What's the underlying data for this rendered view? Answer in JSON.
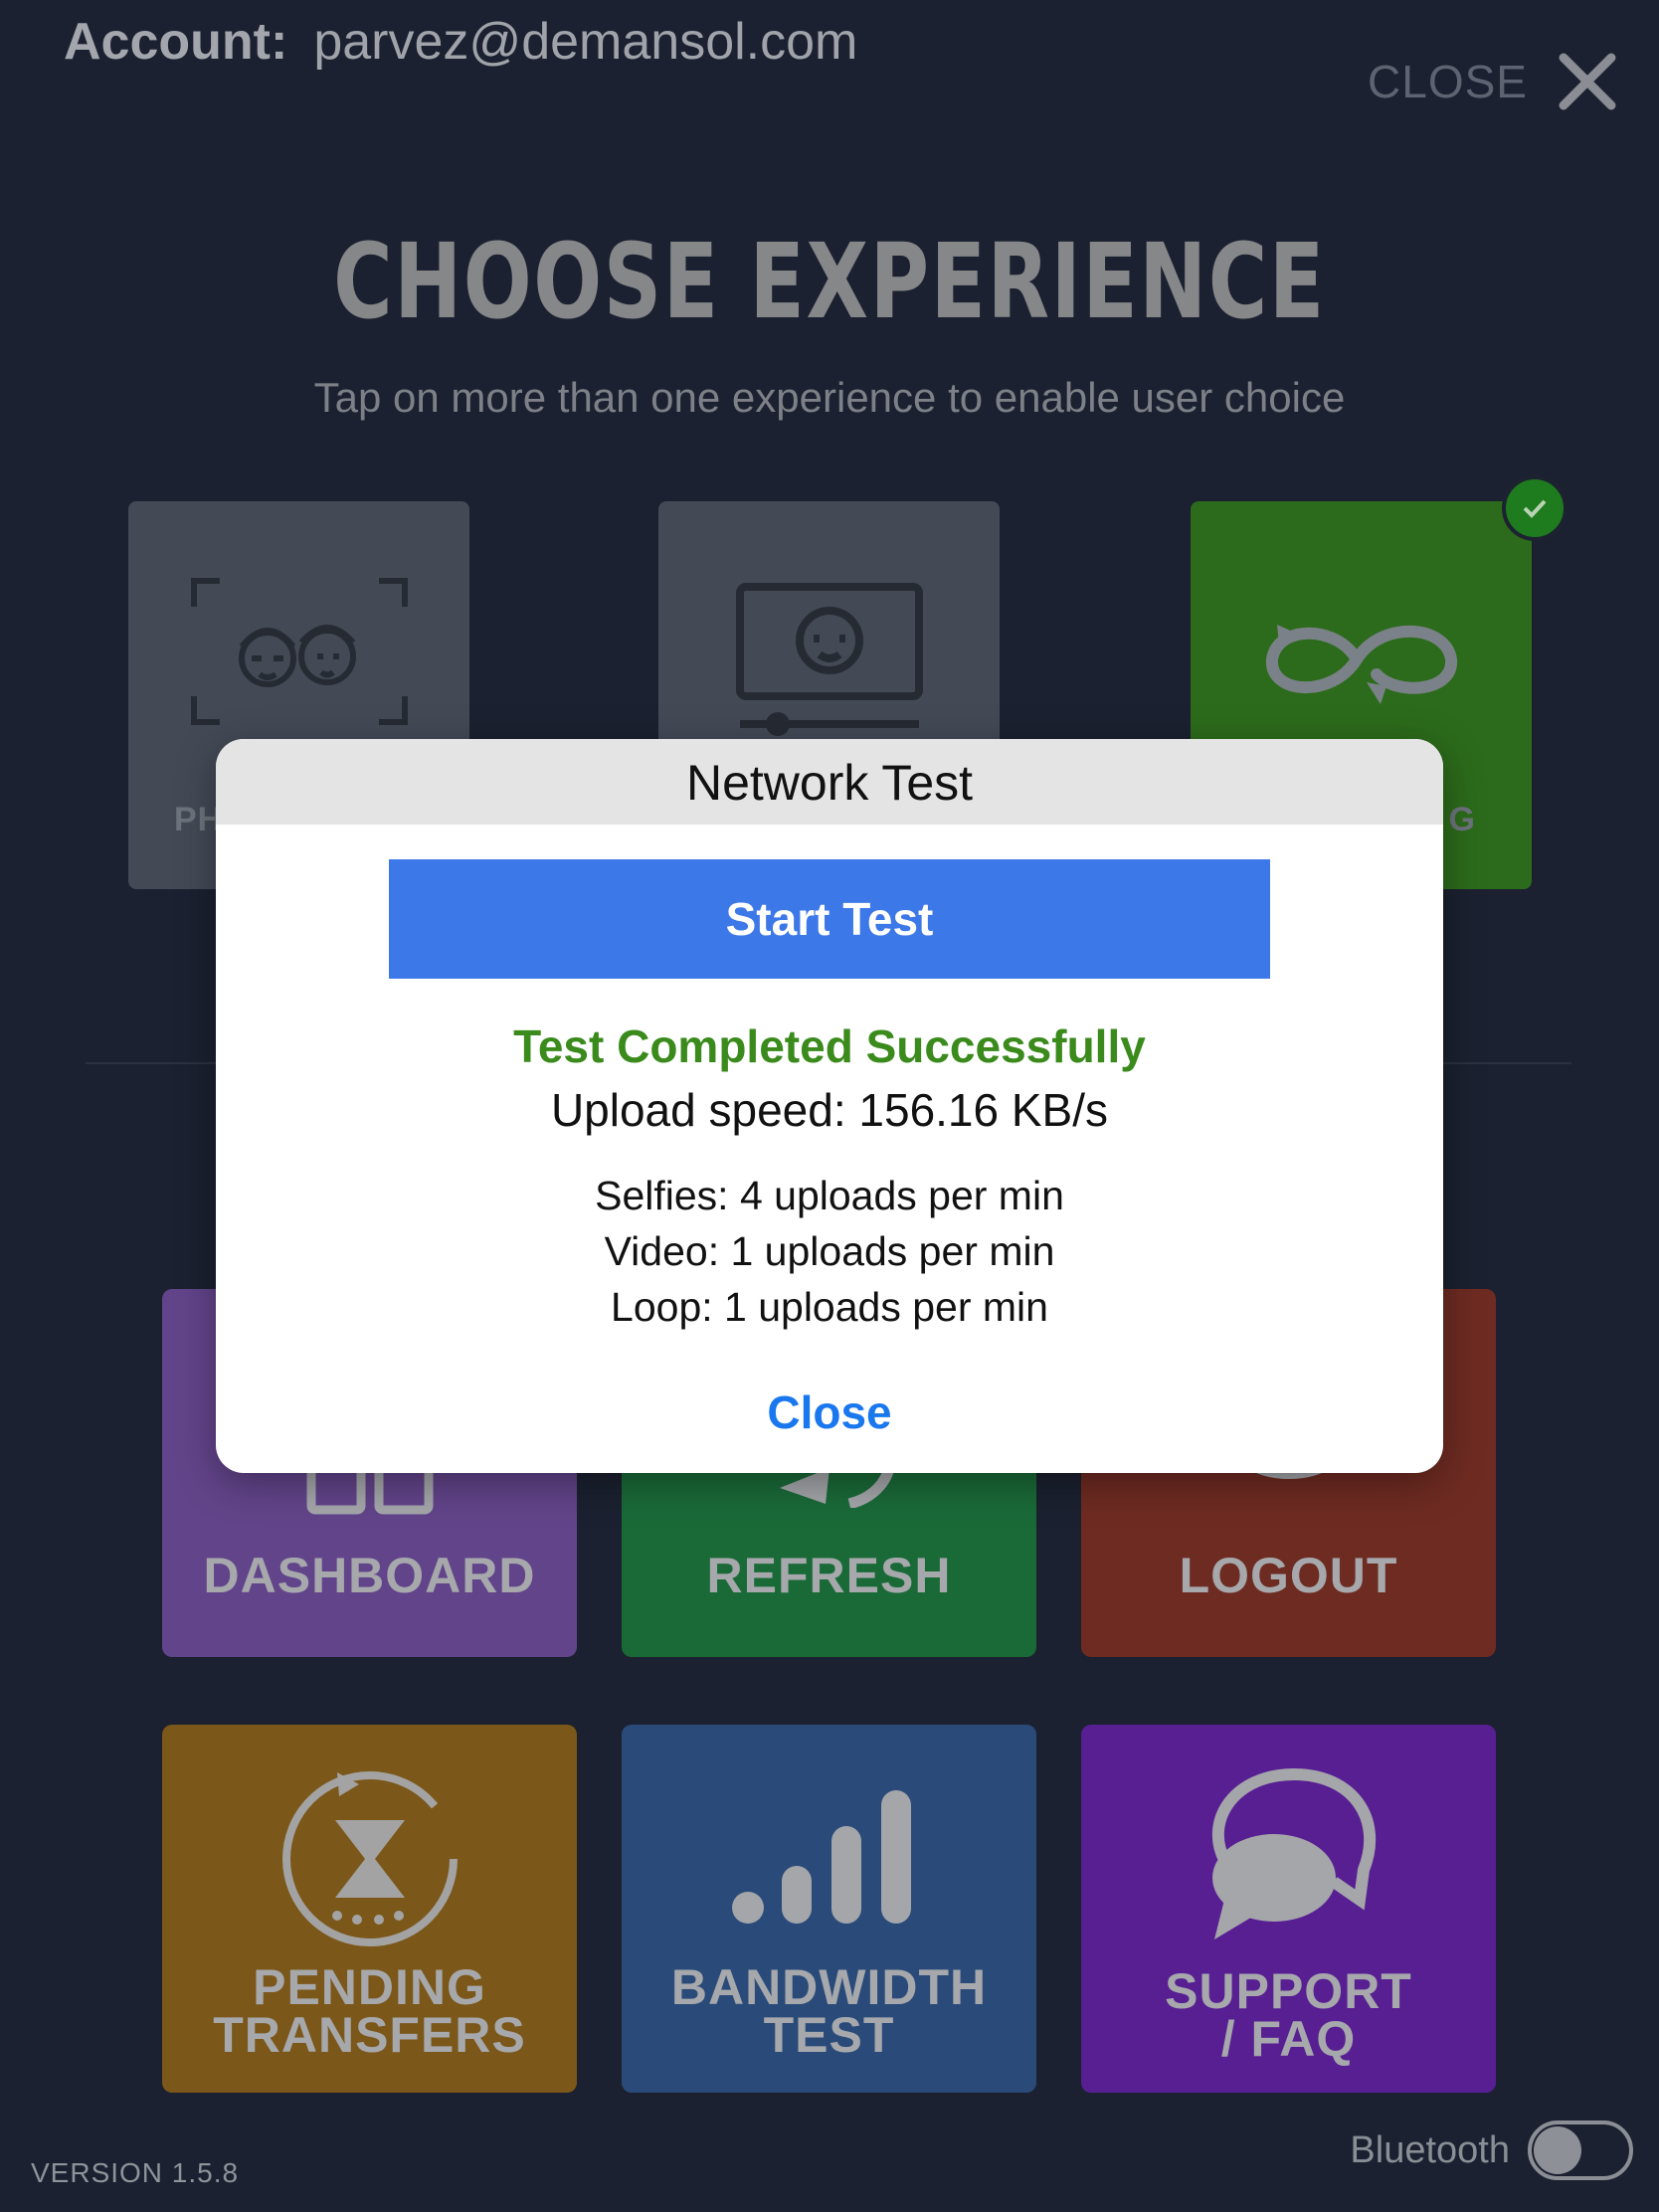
{
  "header": {
    "account_label": "Account:",
    "account_email": "parvez@demansol.com",
    "close_label": "CLOSE"
  },
  "choose": {
    "title": "CHOOSE EXPERIENCE",
    "subtitle": "Tap on more than one experience to enable user choice",
    "tiles": [
      {
        "label": "PH",
        "icon": "photo-selfie-icon",
        "selected": false
      },
      {
        "label": "",
        "icon": "video-player-icon",
        "selected": false
      },
      {
        "label": "G",
        "icon": "loop-icon",
        "selected": true
      }
    ]
  },
  "actions": [
    {
      "label_lines": [
        "DASHBOARD"
      ],
      "icon": "dashboard-icon",
      "color": "#62448a"
    },
    {
      "label_lines": [
        "REFRESH"
      ],
      "icon": "refresh-icon",
      "color": "#1a6a38"
    },
    {
      "label_lines": [
        "LOGOUT"
      ],
      "icon": "logout-icon",
      "color": "#6e2b22"
    },
    {
      "label_lines": [
        "PENDING",
        "TRANSFERS"
      ],
      "icon": "hourglass-icon",
      "color": "#7b5719"
    },
    {
      "label_lines": [
        "BANDWIDTH",
        "TEST"
      ],
      "icon": "signal-bars-icon",
      "color": "#2a4b79"
    },
    {
      "label_lines": [
        "SUPPORT",
        "/ FAQ"
      ],
      "icon": "chat-bubbles-icon",
      "color": "#581f92"
    }
  ],
  "modal": {
    "title": "Network Test",
    "start_button": "Start Test",
    "status": "Test Completed Successfully",
    "upload_speed": "Upload speed: 156.16 KB/s",
    "rates": [
      "Selfies: 4 uploads per min",
      "Video: 1 uploads per min",
      "Loop: 1 uploads per min"
    ],
    "close_button": "Close"
  },
  "footer": {
    "version": "VERSION 1.5.8",
    "bluetooth_label": "Bluetooth",
    "bluetooth_on": false
  },
  "colors": {
    "status_green": "#3a8a1c",
    "primary_blue": "#3c78e7",
    "link_blue": "#1a78ee",
    "selected_check": "#1e7b1e"
  }
}
